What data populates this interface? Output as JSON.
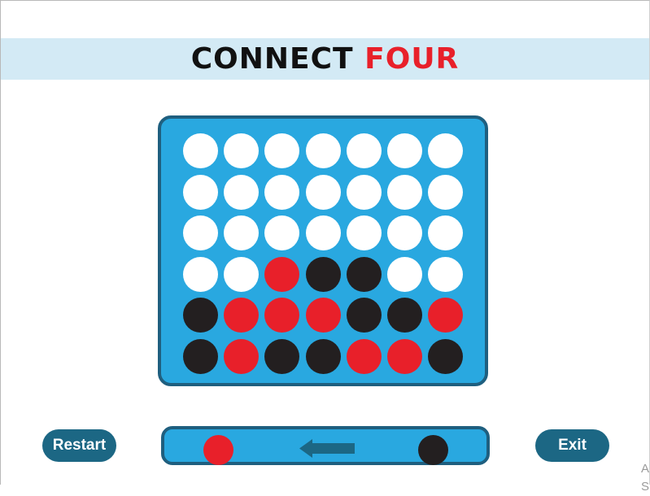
{
  "title": {
    "word1": "CONNECT",
    "word2": "FOUR"
  },
  "colors": {
    "board": "#29a8e0",
    "board_border": "#1f5f7f",
    "empty": "#ffffff",
    "red": "#e8202a",
    "black": "#231f20",
    "button": "#1c6784",
    "title_bar": "#d3eaf5"
  },
  "board": {
    "rows": 6,
    "cols": 7,
    "cells": [
      [
        "empty",
        "empty",
        "empty",
        "empty",
        "empty",
        "empty",
        "empty"
      ],
      [
        "empty",
        "empty",
        "empty",
        "empty",
        "empty",
        "empty",
        "empty"
      ],
      [
        "empty",
        "empty",
        "empty",
        "empty",
        "empty",
        "empty",
        "empty"
      ],
      [
        "empty",
        "empty",
        "red",
        "black",
        "black",
        "empty",
        "empty"
      ],
      [
        "black",
        "red",
        "red",
        "red",
        "black",
        "black",
        "red"
      ],
      [
        "black",
        "red",
        "black",
        "black",
        "red",
        "red",
        "black"
      ]
    ]
  },
  "turn_indicator": {
    "left_player": "red",
    "right_player": "black",
    "arrow_direction": "left",
    "arrow_icon": "left-arrow-icon"
  },
  "buttons": {
    "restart_label": "Restart",
    "exit_label": "Exit"
  },
  "corner_text": "A\nS"
}
